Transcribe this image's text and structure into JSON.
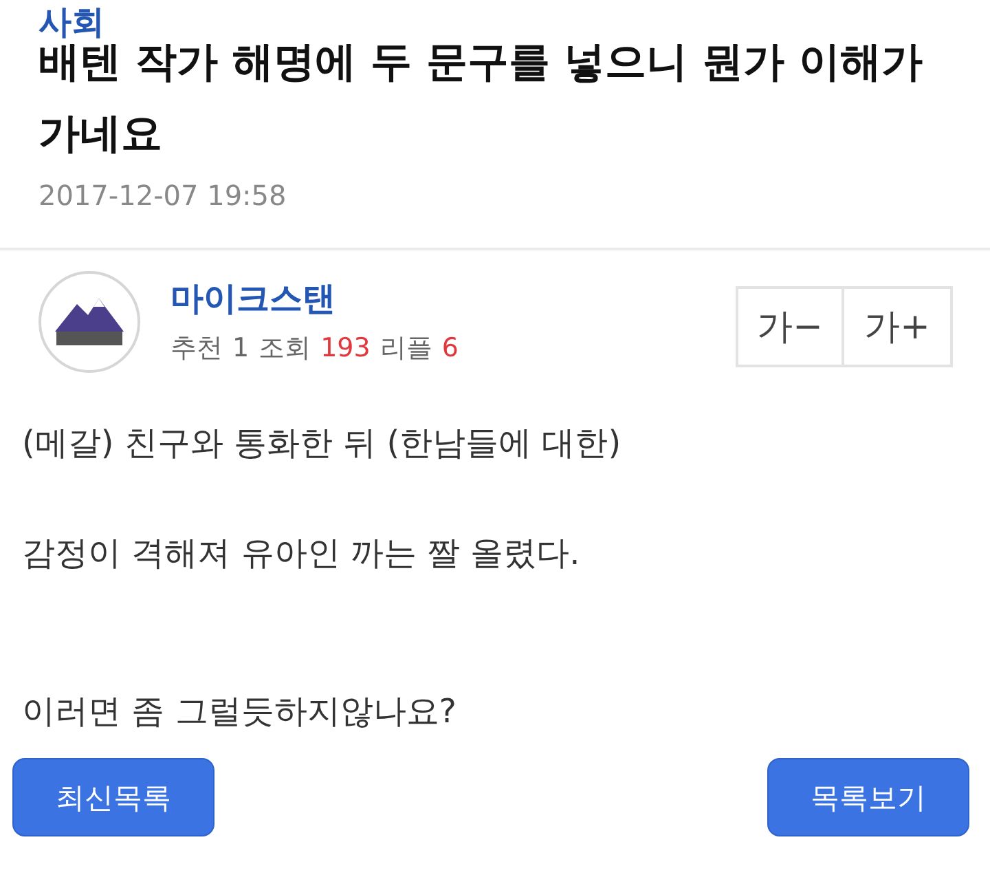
{
  "category": "사회",
  "title": "배텐 작가 해명에 두 문구를 넣으니 뭔가 이해가 가네요",
  "date": "2017-12-07 19:58",
  "author": {
    "name": "마이크스탠",
    "stats": [
      {
        "label": "추천",
        "value": "1",
        "highlighted": false
      },
      {
        "label": "조회",
        "value": "193",
        "highlighted": true
      },
      {
        "label": "리플",
        "value": "6",
        "highlighted": true
      }
    ]
  },
  "font_size_buttons": [
    "가−",
    "가+"
  ],
  "body": [
    {
      "paragraphs": [
        "(메갈) 친구와 통화한 뒤 (한남들에 대한)",
        "감정이 격해져 유아인 까는 짤 올렸다."
      ]
    },
    {
      "paragraphs": [
        "이러면 좀 그럴듯하지않나요?"
      ]
    }
  ],
  "buttons": [
    "최신목록",
    "목록보기"
  ]
}
